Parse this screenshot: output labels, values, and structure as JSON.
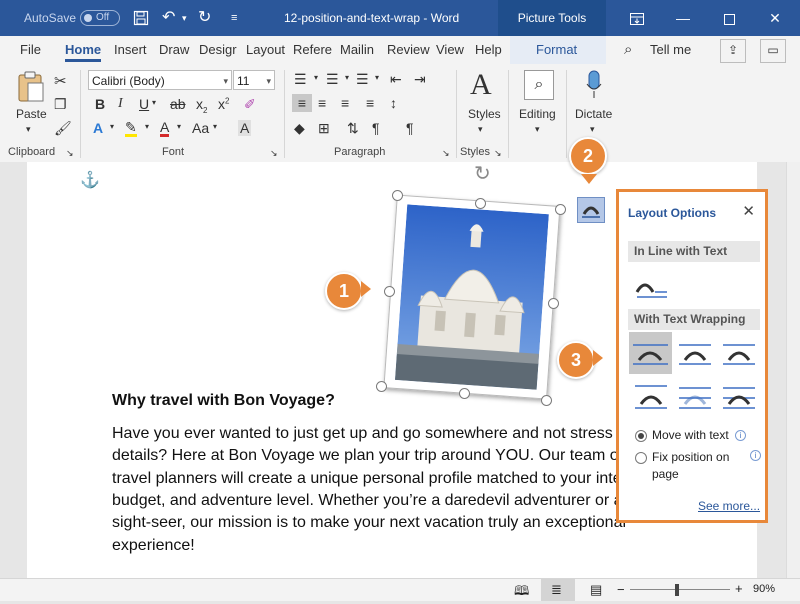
{
  "titlebar": {
    "autosave_label": "AutoSave",
    "autosave_state": "Off",
    "doc_title": "12-position-and-text-wrap - Word",
    "contextual_tab": "Picture Tools"
  },
  "tabs": [
    "File",
    "Home",
    "Insert",
    "Draw",
    "Design",
    "Layout",
    "References",
    "Mailings",
    "Review",
    "View",
    "Help",
    "Format"
  ],
  "tabs_visible": [
    "File",
    "Home",
    "Insert",
    "Draw",
    "Desigr",
    "Layout",
    "Refere",
    "Mailin",
    "Review",
    "View",
    "Help",
    "Format"
  ],
  "tell_me": "Tell me",
  "ribbon": {
    "clipboard": {
      "label": "Clipboard",
      "paste": "Paste"
    },
    "font": {
      "label": "Font",
      "font_name": "Calibri (Body)",
      "font_size": "11"
    },
    "paragraph": {
      "label": "Paragraph"
    },
    "styles": {
      "label": "Styles",
      "styles_btn": "Styles"
    },
    "editing": {
      "label": "Editing"
    },
    "voice": {
      "dictate": "Dictate"
    }
  },
  "document": {
    "heading": "Why travel with Bon Voyage?",
    "lines": [
      "Have you ever wanted to just get up and go somewhere and not stress ove",
      "details?  Here at Bon Voyage we plan your trip around YOU. Our team of e",
      "travel planners will create a unique personal profile matched to your inter",
      "budget, and adventure level. Whether you’re a daredevil adventurer or a c",
      "sight-seer, our mission is to make your next vacation truly an exceptional",
      "experience!"
    ]
  },
  "callouts": [
    "1",
    "2",
    "3"
  ],
  "layout_options": {
    "title": "Layout Options",
    "close": "✕",
    "inline_section": "In Line with Text",
    "wrapping_section": "With Text Wrapping",
    "move_with_text": "Move with text",
    "fix_position": "Fix position on",
    "fix_position_2": "page",
    "see_more": "See more...",
    "selected_option": "Move with text"
  },
  "status": {
    "zoom": "90%",
    "zoom_minus": "−",
    "zoom_plus": "+"
  },
  "colors": {
    "accent": "#2b579a",
    "callout": "#e8883a",
    "selected_wrap": "#b4c7e7"
  }
}
